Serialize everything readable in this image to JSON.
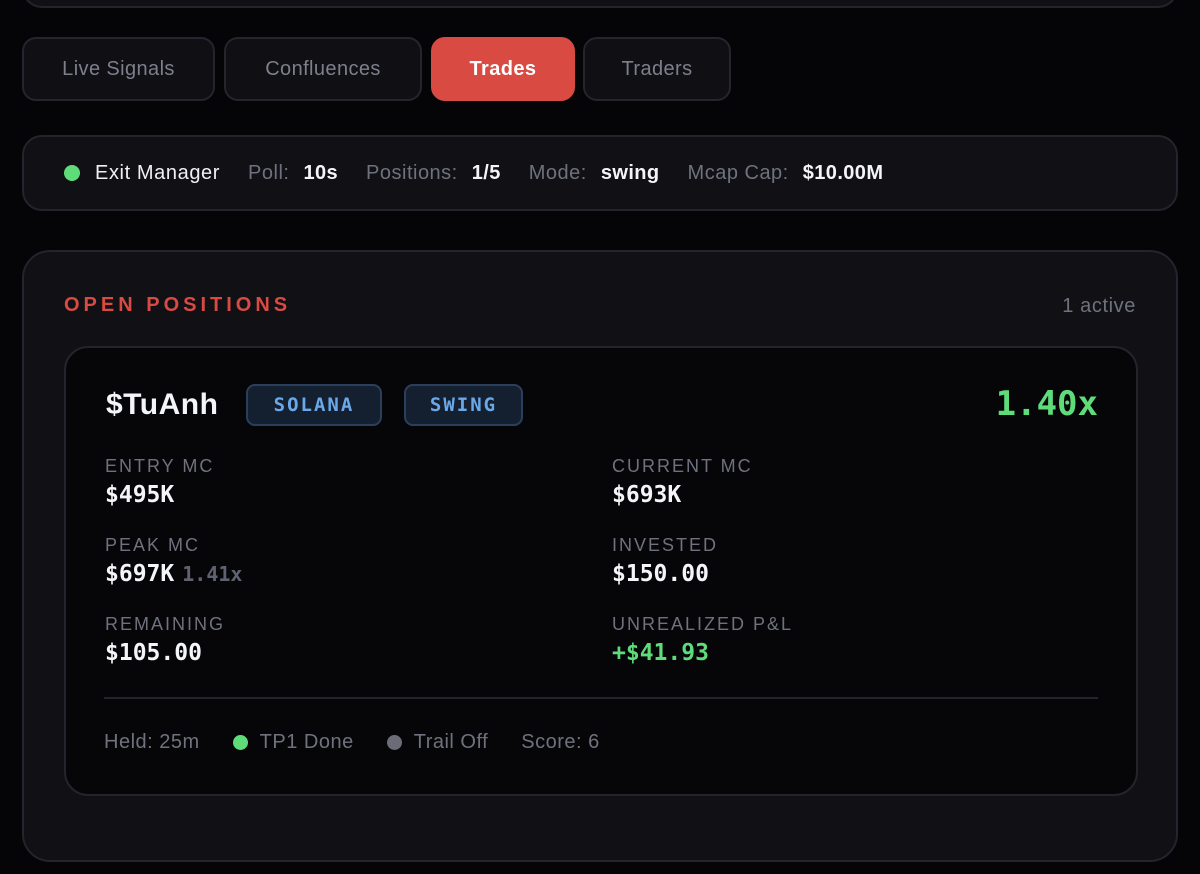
{
  "colors": {
    "accent": "#d84a42",
    "positive": "#5fdc7a",
    "status_active": "#5fdc7a",
    "status_inactive": "#6b6c78",
    "badge_text": "#6aa8ea"
  },
  "tabs": [
    {
      "label": "Live Signals",
      "active": false
    },
    {
      "label": "Confluences",
      "active": false
    },
    {
      "label": "Trades",
      "active": true
    },
    {
      "label": "Traders",
      "active": false
    }
  ],
  "status": {
    "indicator": "active",
    "title": "Exit Manager",
    "poll_label": "Poll:",
    "poll_value": "10s",
    "positions_label": "Positions:",
    "positions_value": "1/5",
    "mode_label": "Mode:",
    "mode_value": "swing",
    "mcap_cap_label": "Mcap Cap:",
    "mcap_cap_value": "$10.00M"
  },
  "open_positions": {
    "title": "OPEN POSITIONS",
    "active_count": "1 active",
    "positions": [
      {
        "token": "$TuAnh",
        "chain_badge": "SOLANA",
        "mode_badge": "SWING",
        "multiplier": "1.40x",
        "entry_mc_label": "ENTRY MC",
        "entry_mc": "$495K",
        "current_mc_label": "CURRENT MC",
        "current_mc": "$693K",
        "peak_mc_label": "PEAK MC",
        "peak_mc": "$697K",
        "peak_multiplier": "1.41x",
        "invested_label": "INVESTED",
        "invested": "$150.00",
        "remaining_label": "REMAINING",
        "remaining": "$105.00",
        "unrealized_label": "UNREALIZED P&L",
        "unrealized": "+$41.93",
        "held": "Held: 25m",
        "tp1_status": "TP1 Done",
        "trail_status": "Trail Off",
        "score": "Score: 6"
      }
    ]
  }
}
